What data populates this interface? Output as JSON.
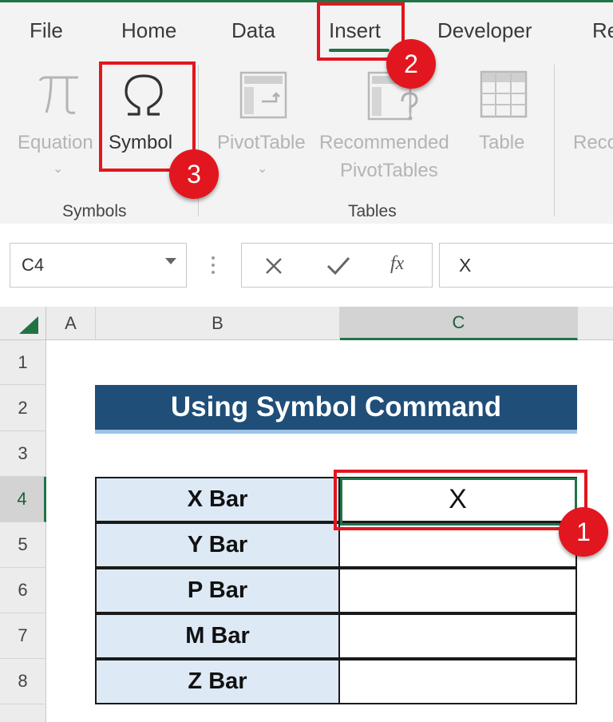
{
  "ribbon": {
    "tabs": [
      "File",
      "Home",
      "Data",
      "Insert",
      "Developer",
      "Re"
    ],
    "commands": {
      "equation": "Equation",
      "symbol": "Symbol",
      "pivottable": "PivotTable",
      "recommended_line1": "Recommended",
      "recommended_line2": "PivotTables",
      "table": "Table",
      "more": "Reco"
    },
    "groups": {
      "symbols": "Symbols",
      "tables": "Tables"
    }
  },
  "formula_bar": {
    "name_box": "C4",
    "fx_label": "fx",
    "value": "X"
  },
  "sheet": {
    "columns": [
      "A",
      "B",
      "C"
    ],
    "selected_column": "C",
    "rows": [
      "1",
      "2",
      "3",
      "4",
      "5",
      "6",
      "7",
      "8"
    ],
    "selected_row": "4",
    "title": "Using Symbol Command",
    "table": [
      {
        "label": "X Bar",
        "value": "X"
      },
      {
        "label": "Y Bar",
        "value": ""
      },
      {
        "label": "P Bar",
        "value": ""
      },
      {
        "label": "M Bar",
        "value": ""
      },
      {
        "label": "Z Bar",
        "value": ""
      }
    ]
  },
  "annotations": {
    "badge_cell": "1",
    "badge_insert": "2",
    "badge_symbol": "3"
  },
  "colors": {
    "excel_green": "#217346",
    "title_fill": "#1f4e79",
    "label_fill": "#dde9f5",
    "highlight_red": "#e2161e"
  }
}
